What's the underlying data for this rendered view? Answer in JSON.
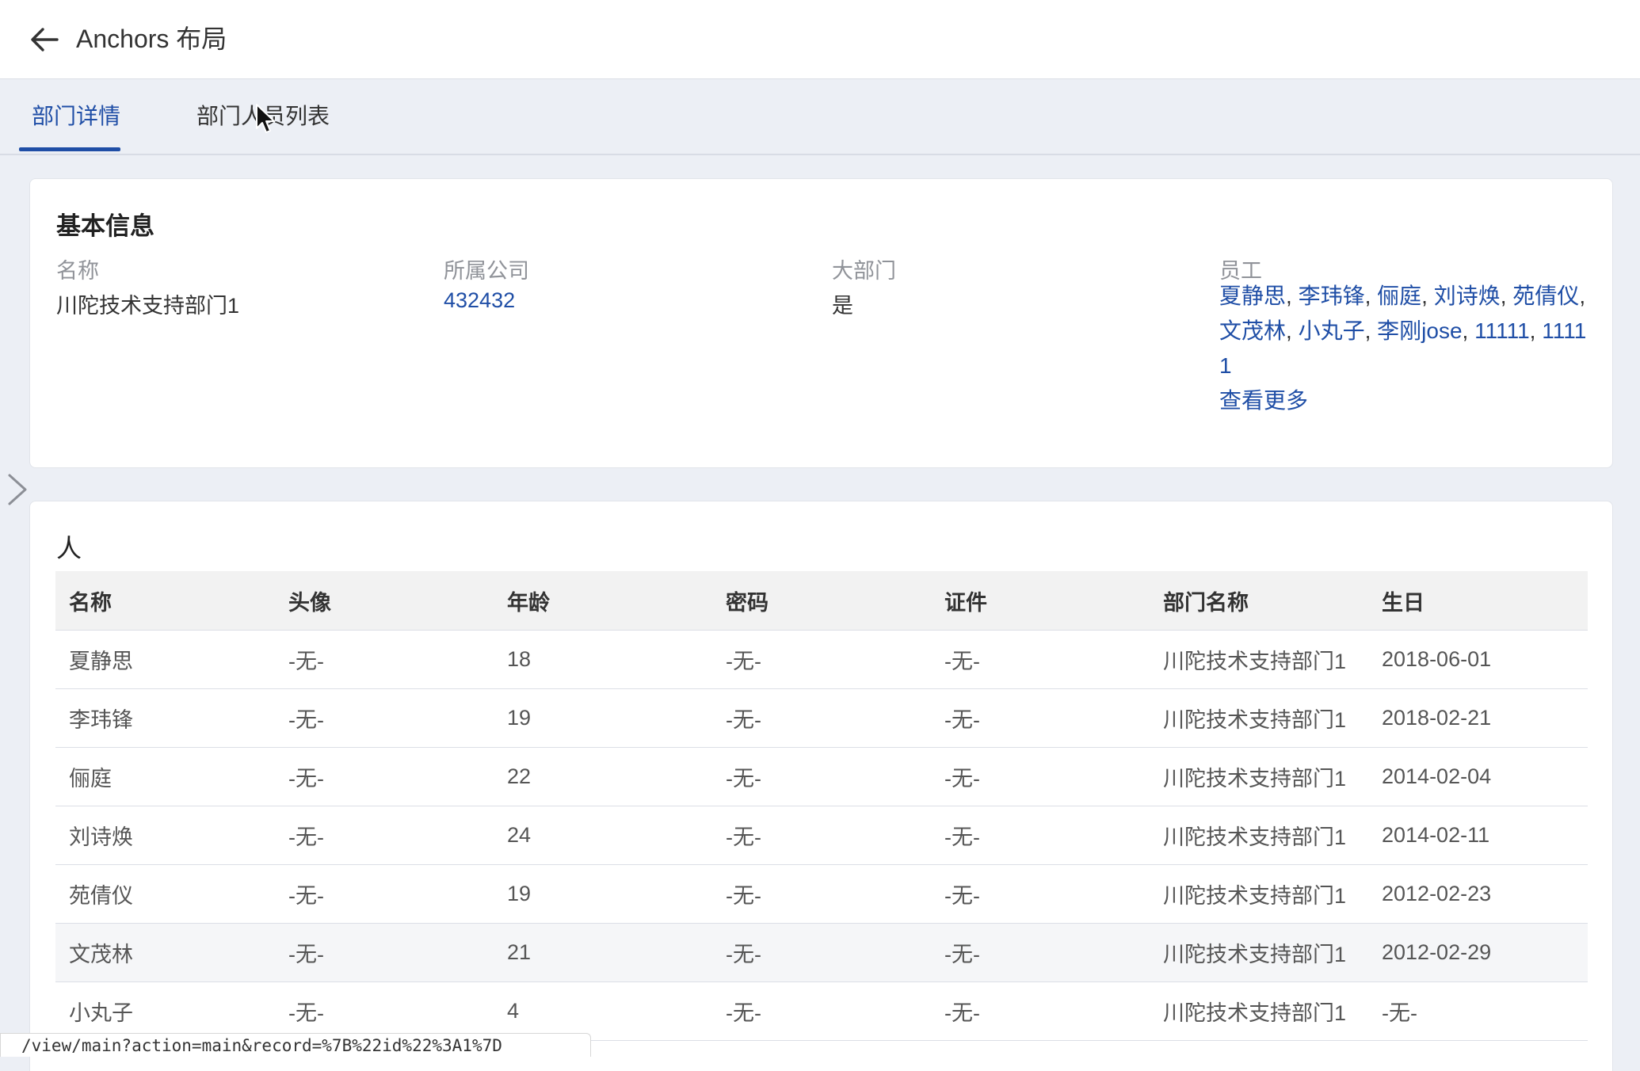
{
  "header": {
    "title": "Anchors 布局"
  },
  "tabs": [
    {
      "label": "部门详情",
      "active": true
    },
    {
      "label": "部门人员列表",
      "active": false
    }
  ],
  "basic_info": {
    "title": "基本信息",
    "name_label": "名称",
    "name_value": "川陀技术支持部门1",
    "company_label": "所属公司",
    "company_value": "432432",
    "big_dept_label": "大部门",
    "big_dept_value": "是",
    "staff_label": "员工",
    "staff": [
      "夏静思",
      "李玮锋",
      "俪庭",
      "刘诗焕",
      "苑倩仪",
      "文茂林",
      "小丸子",
      "李刚jose",
      "11111",
      "11111"
    ],
    "more_label": "查看更多"
  },
  "people": {
    "title": "人",
    "columns": [
      "名称",
      "头像",
      "年龄",
      "密码",
      "证件",
      "部门名称",
      "生日"
    ],
    "rows": [
      [
        "夏静思",
        "-无-",
        "18",
        "-无-",
        "-无-",
        "川陀技术支持部门1",
        "2018-06-01"
      ],
      [
        "李玮锋",
        "-无-",
        "19",
        "-无-",
        "-无-",
        "川陀技术支持部门1",
        "2018-02-21"
      ],
      [
        "俪庭",
        "-无-",
        "22",
        "-无-",
        "-无-",
        "川陀技术支持部门1",
        "2014-02-04"
      ],
      [
        "刘诗焕",
        "-无-",
        "24",
        "-无-",
        "-无-",
        "川陀技术支持部门1",
        "2014-02-11"
      ],
      [
        "苑倩仪",
        "-无-",
        "19",
        "-无-",
        "-无-",
        "川陀技术支持部门1",
        "2012-02-23"
      ],
      [
        "文茂林",
        "-无-",
        "21",
        "-无-",
        "-无-",
        "川陀技术支持部门1",
        "2012-02-29"
      ],
      [
        "小丸子",
        "-无-",
        "4",
        "-无-",
        "-无-",
        "川陀技术支持部门1",
        "-无-"
      ]
    ]
  },
  "status_url": "/view/main?action=main&record=%7B%22id%22%3A1%7D",
  "colors": {
    "accent": "#1f4ea6",
    "background": "#eceff5",
    "header_row": "#f2f2f2"
  }
}
